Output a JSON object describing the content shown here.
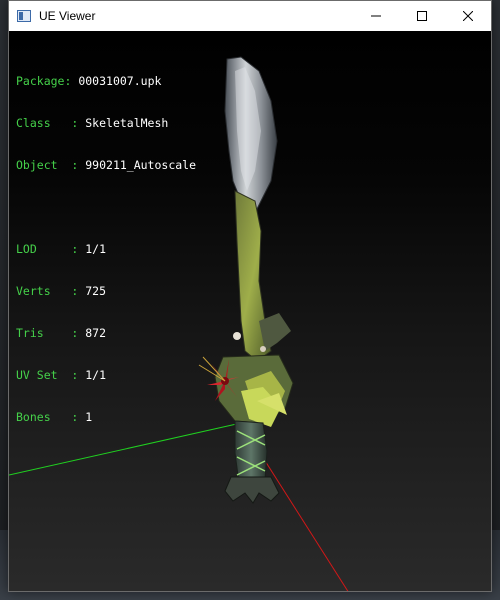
{
  "window": {
    "title": "UE Viewer",
    "buttons": {
      "minimize": "minimize-icon",
      "maximize": "maximize-icon",
      "close": "close-icon"
    }
  },
  "info": {
    "package_label": "Package",
    "package_value": "00031007.upk",
    "class_label": "Class",
    "class_value": "SkeletalMesh",
    "object_label": "Object",
    "object_value": "990211_Autoscale",
    "lod_label": "LOD",
    "lod_value": "1/1",
    "verts_label": "Verts",
    "verts_value": "725",
    "tris_label": "Tris",
    "tris_value": "872",
    "uvset_label": "UV Set",
    "uvset_value": "1/1",
    "bones_label": "Bones",
    "bones_value": "1"
  },
  "colors": {
    "label_green": "#45d14a",
    "value_white": "#ffffff",
    "axis_x": "#d01818",
    "axis_y": "#20d020"
  }
}
